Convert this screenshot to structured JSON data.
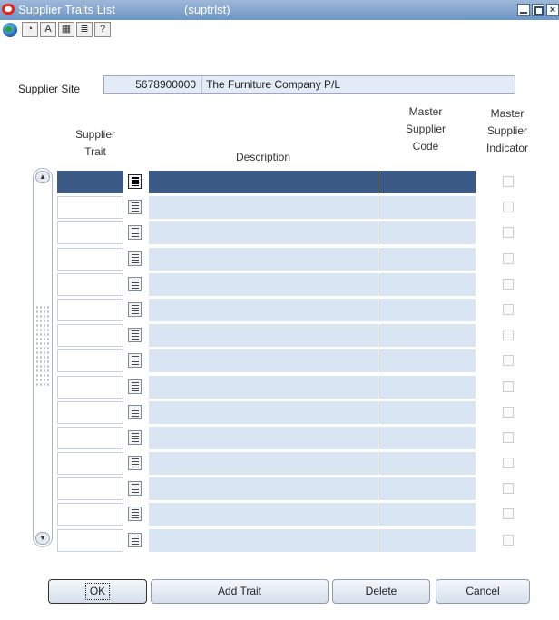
{
  "window": {
    "title": "Supplier Traits List",
    "form_name": "(suptrlst)",
    "controls": [
      "minimize",
      "maximize",
      "close"
    ]
  },
  "toolbar": {
    "icons": [
      "globe-icon",
      "action-icon",
      "font-icon",
      "calendar-icon",
      "editor-icon",
      "help-icon"
    ]
  },
  "supplier_site": {
    "label": "Supplier Site",
    "code": "5678900000",
    "name": "The Furniture Company P/L"
  },
  "columns": {
    "trait": [
      "Supplier",
      "Trait"
    ],
    "description": "Description",
    "master_code": [
      "Master",
      "Supplier",
      "Code"
    ],
    "master_indicator": [
      "Master",
      "Supplier",
      "Indicator"
    ]
  },
  "grid": {
    "row_count": 15,
    "active_row": 0,
    "rows": [
      {
        "trait": "",
        "description": "",
        "master_code": "",
        "indicator": false
      },
      {
        "trait": "",
        "description": "",
        "master_code": "",
        "indicator": false
      },
      {
        "trait": "",
        "description": "",
        "master_code": "",
        "indicator": false
      },
      {
        "trait": "",
        "description": "",
        "master_code": "",
        "indicator": false
      },
      {
        "trait": "",
        "description": "",
        "master_code": "",
        "indicator": false
      },
      {
        "trait": "",
        "description": "",
        "master_code": "",
        "indicator": false
      },
      {
        "trait": "",
        "description": "",
        "master_code": "",
        "indicator": false
      },
      {
        "trait": "",
        "description": "",
        "master_code": "",
        "indicator": false
      },
      {
        "trait": "",
        "description": "",
        "master_code": "",
        "indicator": false
      },
      {
        "trait": "",
        "description": "",
        "master_code": "",
        "indicator": false
      },
      {
        "trait": "",
        "description": "",
        "master_code": "",
        "indicator": false
      },
      {
        "trait": "",
        "description": "",
        "master_code": "",
        "indicator": false
      },
      {
        "trait": "",
        "description": "",
        "master_code": "",
        "indicator": false
      },
      {
        "trait": "",
        "description": "",
        "master_code": "",
        "indicator": false
      },
      {
        "trait": "",
        "description": "",
        "master_code": "",
        "indicator": false
      }
    ]
  },
  "buttons": {
    "ok": "OK",
    "add_trait": "Add Trait",
    "delete": "Delete",
    "cancel": "Cancel"
  },
  "colors": {
    "title_bar": "#7fa0cc",
    "active_row": "#3c5a86",
    "readonly_cell": "#d9e5f2"
  }
}
